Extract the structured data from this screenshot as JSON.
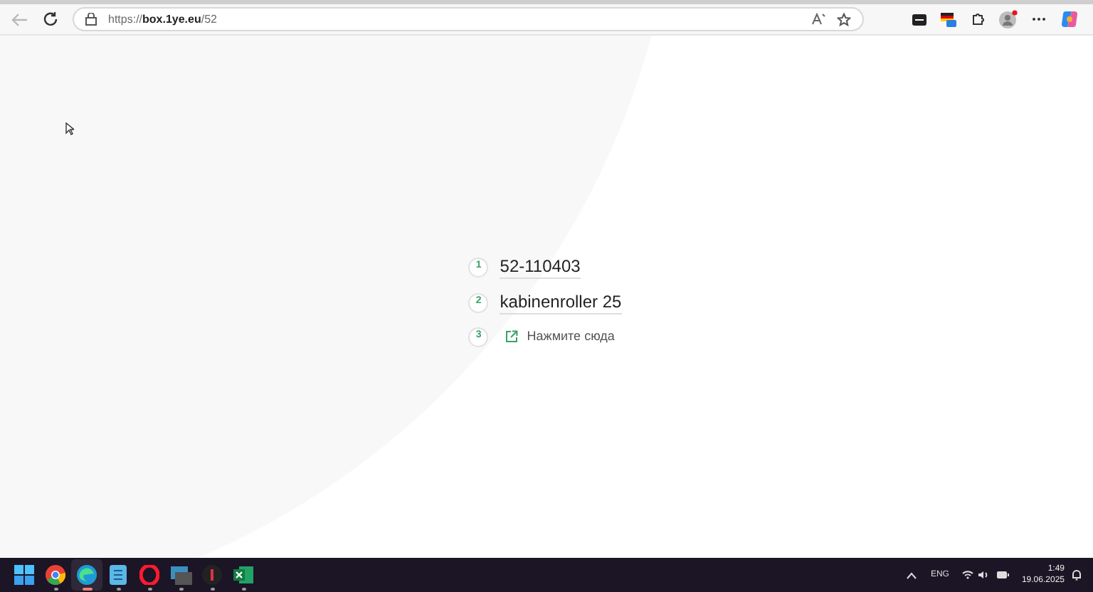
{
  "browser": {
    "address": "https://**box.1ye.eu**/52"
  },
  "steps": [
    {
      "number": "1",
      "kind": "text",
      "text": "52-110403"
    },
    {
      "number": "2",
      "kind": "text",
      "text": "kabinenroller 25"
    },
    {
      "number": "3",
      "kind": "link",
      "text": "Нажмите сюда"
    }
  ],
  "taskbar": {
    "apps": [
      {
        "kind": "start",
        "running": false,
        "selected": false
      },
      {
        "kind": "chrome",
        "running": true,
        "selected": false
      },
      {
        "kind": "edge",
        "running": true,
        "selected": true
      },
      {
        "kind": "notes",
        "running": true,
        "selected": false
      },
      {
        "kind": "opera",
        "running": true,
        "selected": false
      },
      {
        "kind": "window",
        "running": true,
        "selected": false
      },
      {
        "kind": "dark",
        "running": true,
        "selected": false
      },
      {
        "kind": "excel",
        "running": true,
        "selected": false
      }
    ],
    "language": "ENG",
    "time": "1:49",
    "date": "19.06.2025"
  }
}
